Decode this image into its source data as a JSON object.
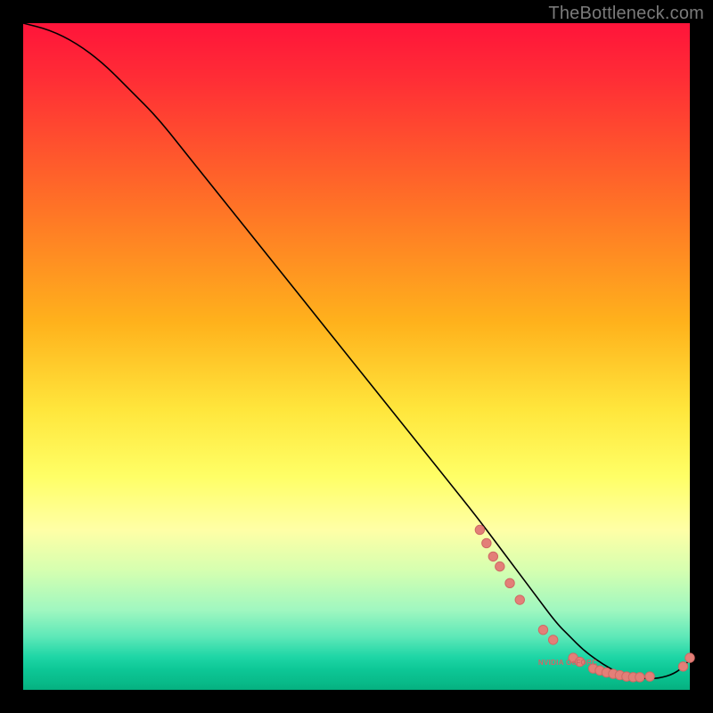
{
  "watermark": "TheBottleneck.com",
  "badge_text": "NVIDIA GeFORC",
  "colors": {
    "curve": "#000000",
    "dot_fill": "#e37f78",
    "dot_stroke": "#cf6964",
    "label": "#ce6868"
  },
  "chart_data": {
    "type": "line",
    "title": "",
    "xlabel": "",
    "ylabel": "",
    "xlim": [
      0,
      100
    ],
    "ylim": [
      0,
      100
    ],
    "curve": {
      "x": [
        0,
        4,
        8,
        12,
        16,
        20,
        24,
        28,
        32,
        36,
        40,
        44,
        48,
        52,
        56,
        60,
        64,
        68,
        71,
        74,
        77,
        80,
        82,
        84,
        86,
        88,
        90,
        92,
        95,
        98,
        100
      ],
      "y": [
        100,
        99,
        97,
        94,
        90,
        86,
        81,
        76,
        71,
        66,
        61,
        56,
        51,
        46,
        41,
        36,
        31,
        26,
        22,
        18,
        14,
        10,
        8,
        6,
        4.5,
        3.2,
        2.3,
        1.8,
        1.6,
        2.5,
        4.5
      ]
    },
    "dots": [
      {
        "x": 68.5,
        "y": 24.0
      },
      {
        "x": 69.5,
        "y": 22.0
      },
      {
        "x": 70.5,
        "y": 20.0
      },
      {
        "x": 71.5,
        "y": 18.5
      },
      {
        "x": 73.0,
        "y": 16.0
      },
      {
        "x": 74.5,
        "y": 13.5
      },
      {
        "x": 78.0,
        "y": 9.0
      },
      {
        "x": 79.5,
        "y": 7.5
      },
      {
        "x": 82.5,
        "y": 4.8
      },
      {
        "x": 83.5,
        "y": 4.2
      },
      {
        "x": 85.5,
        "y": 3.2
      },
      {
        "x": 86.5,
        "y": 2.9
      },
      {
        "x": 87.5,
        "y": 2.6
      },
      {
        "x": 88.5,
        "y": 2.4
      },
      {
        "x": 89.5,
        "y": 2.2
      },
      {
        "x": 90.5,
        "y": 2.0
      },
      {
        "x": 91.5,
        "y": 1.9
      },
      {
        "x": 92.5,
        "y": 1.9
      },
      {
        "x": 94.0,
        "y": 2.0
      },
      {
        "x": 99.0,
        "y": 3.5
      },
      {
        "x": 100.0,
        "y": 4.8
      }
    ],
    "badge_position": {
      "x": 81.0,
      "y": 4.0
    }
  }
}
